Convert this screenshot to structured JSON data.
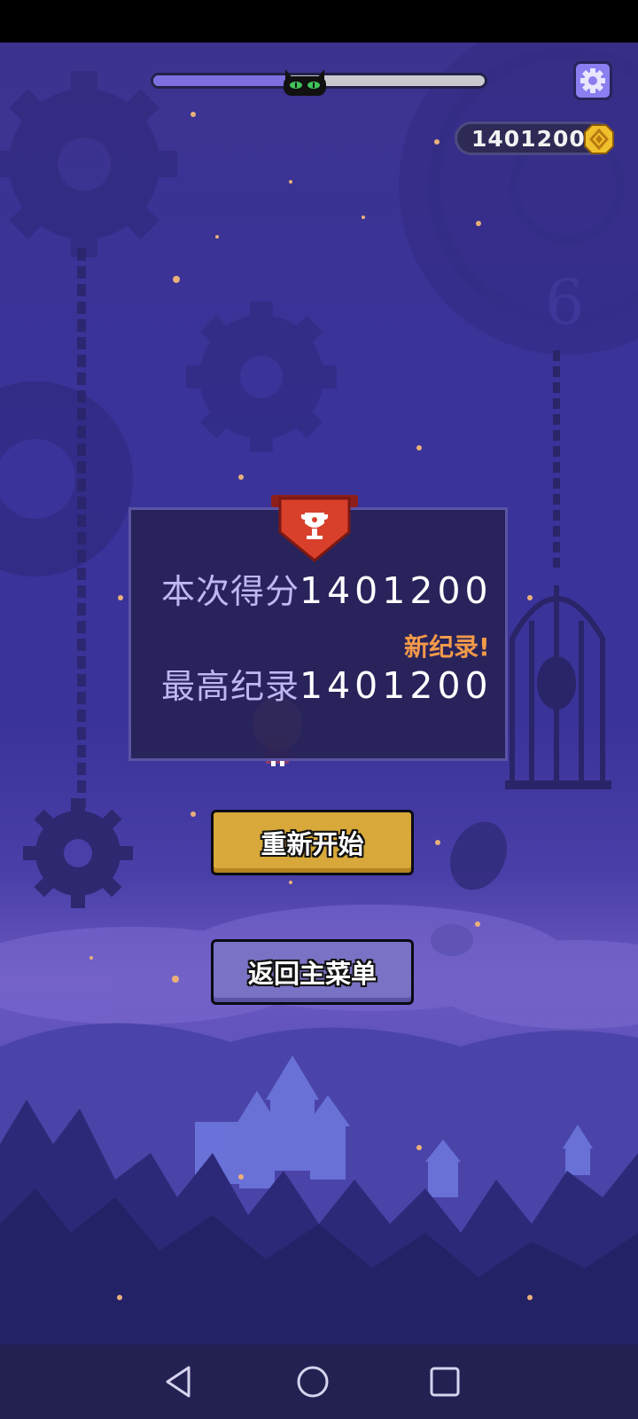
{
  "level_progress": {
    "fraction": 0.4
  },
  "coins": {
    "amount": "1401200"
  },
  "results": {
    "current_score_label": "本次得分",
    "current_score": "1401200",
    "new_record_badge": "新纪录!",
    "best_score_label": "最高纪录",
    "best_score": "1401200"
  },
  "buttons": {
    "restart": "重新开始",
    "main_menu": "返回主菜单"
  },
  "icons": {
    "progress_marker": "black-cat-icon",
    "settings": "gear-icon",
    "coin": "coin-icon",
    "banner": "trophy-icon",
    "nav_back": "triangle-back-icon",
    "nav_home": "circle-home-icon",
    "nav_recents": "square-recents-icon"
  },
  "colors": {
    "restart_button": "#d8a93a",
    "menu_button": "#7a72c4",
    "new_record": "#f39a4a",
    "progress_fill": "#7d6fe0"
  }
}
